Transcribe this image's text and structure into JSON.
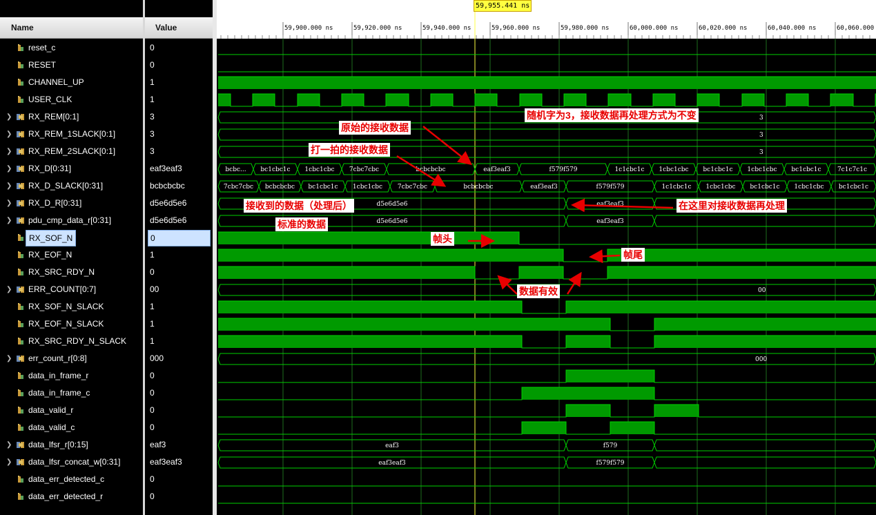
{
  "header": {
    "name": "Name",
    "value": "Value"
  },
  "cursor_time": "59,955.441 ns",
  "time_ticks": [
    "59,900.000 ns",
    "59,920.000 ns",
    "59,940.000 ns",
    "59,960.000 ns",
    "59,980.000 ns",
    "60,000.000 ns",
    "60,020.000 ns",
    "60,040.000 ns",
    "60,060.000 ns"
  ],
  "signals": [
    {
      "name": "reset_c",
      "value": "0",
      "bus": false
    },
    {
      "name": "RESET",
      "value": "0",
      "bus": false
    },
    {
      "name": "CHANNEL_UP",
      "value": "1",
      "bus": false
    },
    {
      "name": "USER_CLK",
      "value": "1",
      "bus": false
    },
    {
      "name": "RX_REM[0:1]",
      "value": "3",
      "bus": true
    },
    {
      "name": "RX_REM_1SLACK[0:1]",
      "value": "3",
      "bus": true
    },
    {
      "name": "RX_REM_2SLACK[0:1]",
      "value": "3",
      "bus": true
    },
    {
      "name": "RX_D[0:31]",
      "value": "eaf3eaf3",
      "bus": true
    },
    {
      "name": "RX_D_SLACK[0:31]",
      "value": "bcbcbcbc",
      "bus": true
    },
    {
      "name": "RX_D_R[0:31]",
      "value": "d5e6d5e6",
      "bus": true
    },
    {
      "name": "pdu_cmp_data_r[0:31]",
      "value": "d5e6d5e6",
      "bus": true
    },
    {
      "name": "RX_SOF_N",
      "value": "0",
      "bus": false,
      "selected": true
    },
    {
      "name": "RX_EOF_N",
      "value": "1",
      "bus": false
    },
    {
      "name": "RX_SRC_RDY_N",
      "value": "0",
      "bus": false
    },
    {
      "name": "ERR_COUNT[0:7]",
      "value": "00",
      "bus": true
    },
    {
      "name": "RX_SOF_N_SLACK",
      "value": "1",
      "bus": false
    },
    {
      "name": "RX_EOF_N_SLACK",
      "value": "1",
      "bus": false
    },
    {
      "name": "RX_SRC_RDY_N_SLACK",
      "value": "1",
      "bus": false
    },
    {
      "name": "err_count_r[0:8]",
      "value": "000",
      "bus": true
    },
    {
      "name": "data_in_frame_r",
      "value": "0",
      "bus": false
    },
    {
      "name": "data_in_frame_c",
      "value": "0",
      "bus": false
    },
    {
      "name": "data_valid_r",
      "value": "0",
      "bus": false
    },
    {
      "name": "data_valid_c",
      "value": "0",
      "bus": false
    },
    {
      "name": "data_lfsr_r[0:15]",
      "value": "eaf3",
      "bus": true
    },
    {
      "name": "data_lfsr_concat_w[0:31]",
      "value": "eaf3eaf3",
      "bus": true
    },
    {
      "name": "data_err_detected_c",
      "value": "0",
      "bus": false
    },
    {
      "name": "data_err_detected_r",
      "value": "0",
      "bus": false
    }
  ],
  "bus_labels": {
    "rx_rem": "3",
    "rx_d": [
      "bcbc...",
      "bc1cbc1c",
      "1cbc1cbc",
      "7cbc7cbc",
      "bcbcbcbc",
      "eaf3eaf3",
      "f579f579",
      "1c1cbc1c",
      "1cbc1cbc",
      "bc1cbc1c",
      "1cbc1cbc",
      "bc1cbc1c",
      "7c1c7c1c"
    ],
    "rx_d_slack": [
      "7cbc7cbc",
      "bcbcbcbc",
      "bc1cbc1c",
      "1cbc1cbc",
      "7cbc7cbc",
      "bcbcbcbc",
      "eaf3eaf3",
      "f579f579",
      "1c1cbc1c",
      "1cbc1cbc",
      "bc1cbc1c",
      "1cbc1cbc",
      "bc1cbc1c"
    ],
    "rx_d_r": [
      "d5e6d5e6",
      "eaf3eaf3"
    ],
    "pdu": [
      "d5e6d5e6",
      "eaf3eaf3"
    ],
    "err_count": "00",
    "err_count_r": "000",
    "lfsr": [
      "eaf3",
      "f579"
    ],
    "lfsr_concat": [
      "eaf3eaf3",
      "f579f579"
    ]
  },
  "annotations": {
    "random_word": "随机字为3，接收数据再处理方式为不变",
    "raw_rx": "原始的接收数据",
    "delayed_rx": "打一拍的接收数据",
    "received_processed": "接收到的数据（处理后）",
    "reprocess_here": "在这里对接收数据再处理",
    "standard_data": "标准的数据",
    "frame_head": "帧头",
    "frame_tail": "帧尾",
    "data_valid": "数据有效"
  },
  "colors": {
    "wave": "#00d000",
    "fill": "#009a00",
    "grid": "#1e6e1e",
    "annotation": "#e80000"
  }
}
